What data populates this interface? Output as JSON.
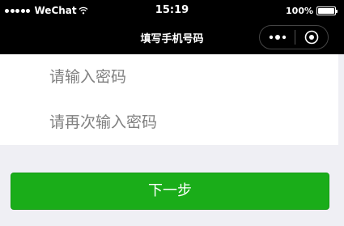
{
  "status_bar": {
    "carrier": "WeChat",
    "signal_icon": "signal-dots-icon",
    "wifi_icon": "wifi-icon",
    "time": "15:19",
    "battery_percent": "100%",
    "battery_level": 1.0,
    "battery_icon": "battery-icon"
  },
  "nav_bar": {
    "title": "填写手机号码",
    "more_icon": "more-dots-icon",
    "close_icon": "target-close-icon"
  },
  "form": {
    "password": {
      "value": "",
      "placeholder": "请输入密码"
    },
    "confirm_password": {
      "value": "",
      "placeholder": "请再次输入密码"
    }
  },
  "actions": {
    "next_label": "下一步"
  },
  "colors": {
    "background": "#efeff4",
    "nav_background": "#000000",
    "primary_button": "#1aad19",
    "placeholder": "#808080"
  }
}
